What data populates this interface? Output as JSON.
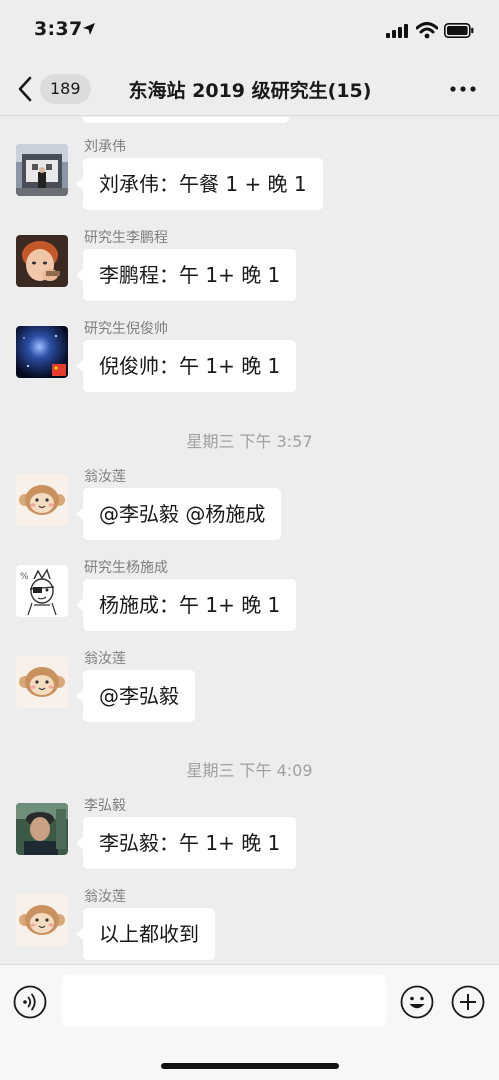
{
  "status_bar": {
    "time": "3:37"
  },
  "nav": {
    "unread_count": "189",
    "title": "东海站 2019 级研究生(15)"
  },
  "messages": [
    {
      "sender": "刘承伟",
      "text": "刘承伟：午餐 1 + 晚 1",
      "avatar": "street-photo-avatar"
    },
    {
      "sender": "研究生李鹏程",
      "text": "李鹏程：午 1+ 晚 1",
      "avatar": "red-hair-boy-avatar"
    },
    {
      "sender": "研究生倪俊帅",
      "text": "倪俊帅：午 1+ 晚 1",
      "avatar": "galaxy-avatar"
    },
    {
      "sender": "翁汝莲",
      "text": "@李弘毅 @杨施成",
      "avatar": "monkey-avatar"
    },
    {
      "sender": "研究生杨施成",
      "text": "杨施成：午 1+ 晚 1",
      "avatar": "sketch-character-avatar"
    },
    {
      "sender": "翁汝莲",
      "text": "@李弘毅",
      "avatar": "monkey-avatar"
    },
    {
      "sender": "李弘毅",
      "text": "李弘毅：午 1+ 晚 1",
      "avatar": "photo-person-avatar"
    },
    {
      "sender": "翁汝莲",
      "text": "以上都收到",
      "avatar": "monkey-avatar"
    }
  ],
  "timestamps": [
    "星期三 下午 3:57",
    "星期三 下午 4:09"
  ],
  "input": {
    "placeholder": ""
  }
}
